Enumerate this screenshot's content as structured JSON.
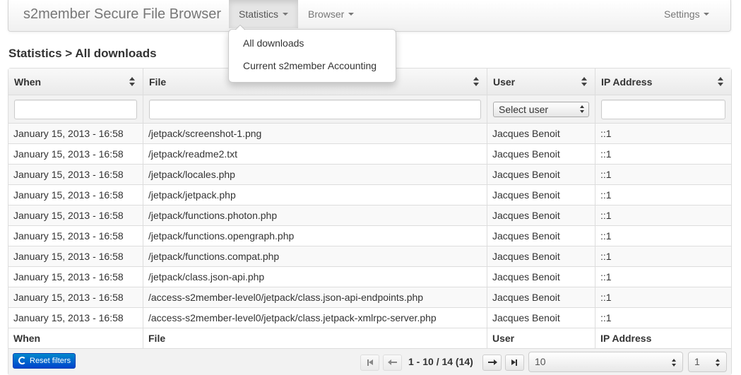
{
  "navbar": {
    "brand": "s2member Secure File Browser",
    "items": [
      {
        "label": "Statistics",
        "active": true
      },
      {
        "label": "Browser",
        "active": false
      },
      {
        "label": "Settings",
        "active": false
      }
    ]
  },
  "dropdown": {
    "items": [
      "All downloads",
      "Current s2member Accounting"
    ]
  },
  "page": {
    "title": "Statistics > All downloads"
  },
  "table": {
    "columns": [
      "When",
      "File",
      "User",
      "IP Address"
    ],
    "filters": {
      "when_value": "",
      "file_value": "",
      "user_selected": "Select user",
      "ip_value": ""
    },
    "rows": [
      {
        "when": "January 15, 2013 - 16:58",
        "file": "/jetpack/screenshot-1.png",
        "user": "Jacques Benoit",
        "ip": "::1"
      },
      {
        "when": "January 15, 2013 - 16:58",
        "file": "/jetpack/readme2.txt",
        "user": "Jacques Benoit",
        "ip": "::1"
      },
      {
        "when": "January 15, 2013 - 16:58",
        "file": "/jetpack/locales.php",
        "user": "Jacques Benoit",
        "ip": "::1"
      },
      {
        "when": "January 15, 2013 - 16:58",
        "file": "/jetpack/jetpack.php",
        "user": "Jacques Benoit",
        "ip": "::1"
      },
      {
        "when": "January 15, 2013 - 16:58",
        "file": "/jetpack/functions.photon.php",
        "user": "Jacques Benoit",
        "ip": "::1"
      },
      {
        "when": "January 15, 2013 - 16:58",
        "file": "/jetpack/functions.opengraph.php",
        "user": "Jacques Benoit",
        "ip": "::1"
      },
      {
        "when": "January 15, 2013 - 16:58",
        "file": "/jetpack/functions.compat.php",
        "user": "Jacques Benoit",
        "ip": "::1"
      },
      {
        "when": "January 15, 2013 - 16:58",
        "file": "/jetpack/class.json-api.php",
        "user": "Jacques Benoit",
        "ip": "::1"
      },
      {
        "when": "January 15, 2013 - 16:58",
        "file": "/access-s2member-level0/jetpack/class.json-api-endpoints.php",
        "user": "Jacques Benoit",
        "ip": "::1"
      },
      {
        "when": "January 15, 2013 - 16:58",
        "file": "/access-s2member-level0/jetpack/class.jetpack-xmlrpc-server.php",
        "user": "Jacques Benoit",
        "ip": "::1"
      }
    ]
  },
  "pager": {
    "reset_label": "Reset filters",
    "info": "1 - 10 / 14 (14)",
    "page_size": "10",
    "page_number": "1"
  },
  "colors": {
    "reset_button": "#0055cc"
  }
}
